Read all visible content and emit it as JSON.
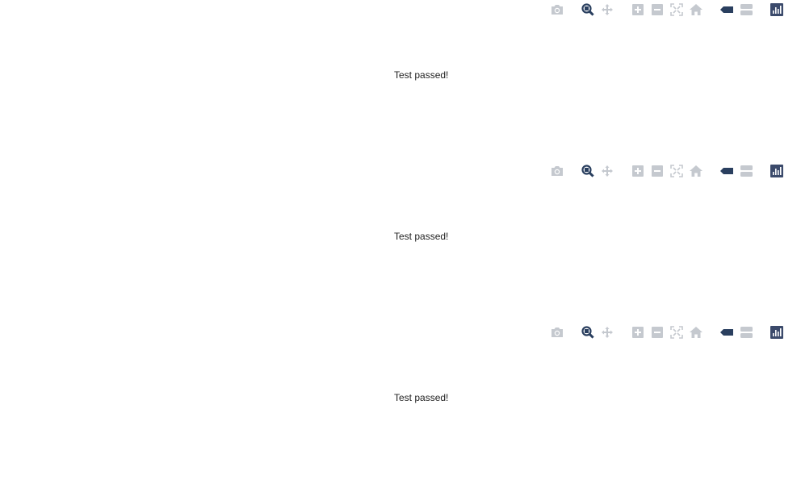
{
  "colors": {
    "icon_inactive": "#c5c9cf",
    "icon_active": "#2a3f5f",
    "logo_bg": "#3b4a6b",
    "logo_bars": "#ffffff",
    "text": "#222222"
  },
  "panels": [
    {
      "status_text": "Test passed!",
      "modebar": {
        "groups": [
          [
            "camera-icon"
          ],
          [
            "zoom-icon",
            "pan-icon"
          ],
          [
            "zoom-in-icon",
            "zoom-out-icon",
            "autoscale-icon",
            "reset-axes-icon"
          ],
          [
            "hover-closest-icon",
            "hover-compare-icon"
          ],
          [
            "logo-icon"
          ]
        ],
        "active": "zoom-icon"
      }
    },
    {
      "status_text": "Test passed!",
      "modebar": {
        "groups": [
          [
            "camera-icon"
          ],
          [
            "zoom-icon",
            "pan-icon"
          ],
          [
            "zoom-in-icon",
            "zoom-out-icon",
            "autoscale-icon",
            "reset-axes-icon"
          ],
          [
            "hover-closest-icon",
            "hover-compare-icon"
          ],
          [
            "logo-icon"
          ]
        ],
        "active": "zoom-icon"
      }
    },
    {
      "status_text": "Test passed!",
      "modebar": {
        "groups": [
          [
            "camera-icon"
          ],
          [
            "zoom-icon",
            "pan-icon"
          ],
          [
            "zoom-in-icon",
            "zoom-out-icon",
            "autoscale-icon",
            "reset-axes-icon"
          ],
          [
            "hover-closest-icon",
            "hover-compare-icon"
          ],
          [
            "logo-icon"
          ]
        ],
        "active": "zoom-icon"
      }
    }
  ]
}
